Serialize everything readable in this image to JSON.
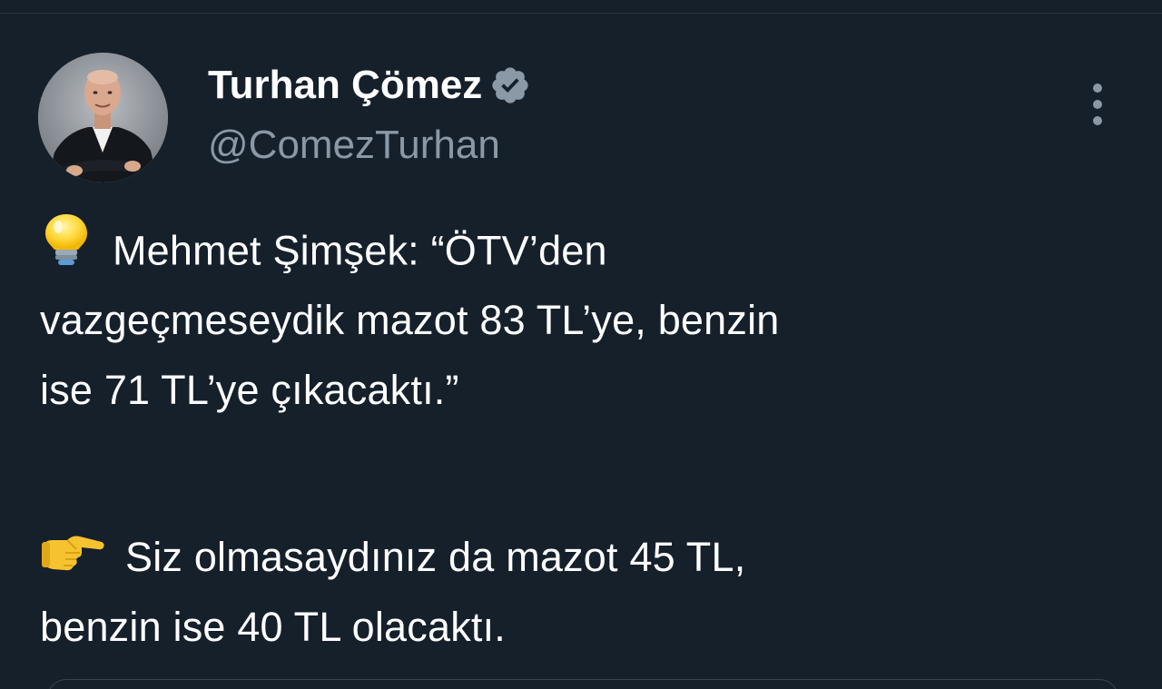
{
  "tweet": {
    "author": {
      "display_name": "Turhan Çömez",
      "handle": "@ComezTurhan",
      "verified_icon": "verified-badge-icon",
      "avatar": "profile-photo-man-in-suit-arms-crossed"
    },
    "menu_icon": "more-options-icon",
    "paragraphs": [
      {
        "emoji": "light-bulb-icon",
        "lines": [
          "Mehmet Şimşek: “ÖTV’den",
          "vazgeçmeseydik mazot 83 TL’ye, benzin",
          "ise 71 TL’ye çıkacaktı.”"
        ]
      },
      {
        "emoji": "pointing-right-hand-icon",
        "lines": [
          "Siz olmasaydınız da mazot 45 TL,",
          "benzin ise 40 TL olacaktı."
        ]
      }
    ]
  },
  "colors": {
    "background": "#15202b",
    "text_primary": "#ffffff",
    "text_secondary": "#8b98a5",
    "border": "#38444d"
  }
}
